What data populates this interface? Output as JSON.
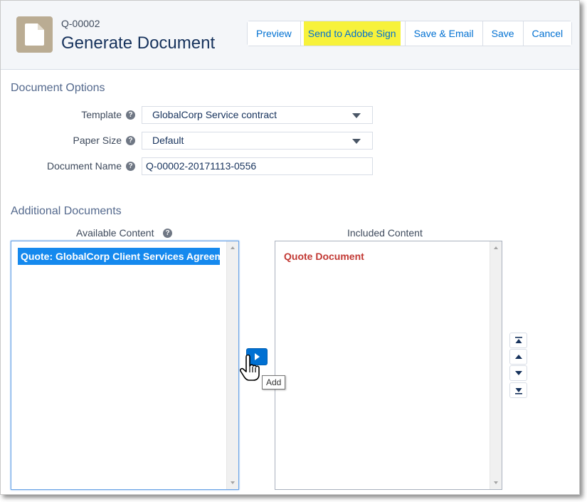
{
  "header": {
    "record_id": "Q-00002",
    "title": "Generate Document",
    "icon": "document-icon",
    "buttons": {
      "preview": "Preview",
      "send_adobe": "Send to Adobe Sign",
      "save_email": "Save & Email",
      "save": "Save",
      "cancel": "Cancel"
    }
  },
  "document_options": {
    "title": "Document Options",
    "template": {
      "label": "Template",
      "value": "GlobalCorp Service contract"
    },
    "paper_size": {
      "label": "Paper Size",
      "value": "Default"
    },
    "document_name": {
      "label": "Document Name",
      "value": "Q-00002-20171113-0556"
    }
  },
  "additional_documents": {
    "title": "Additional Documents",
    "available": {
      "label": "Available Content",
      "items": [
        "Quote: GlobalCorp Client Services Agreement"
      ]
    },
    "included": {
      "label": "Included Content",
      "items": [
        "Quote Document"
      ]
    },
    "add_tooltip": "Add",
    "help_glyph": "?"
  },
  "colors": {
    "accent": "#0070d2",
    "highlight": "#f7f23b",
    "selected": "#1589ee",
    "included_text": "#c23934",
    "icon_bg": "#baac93"
  }
}
